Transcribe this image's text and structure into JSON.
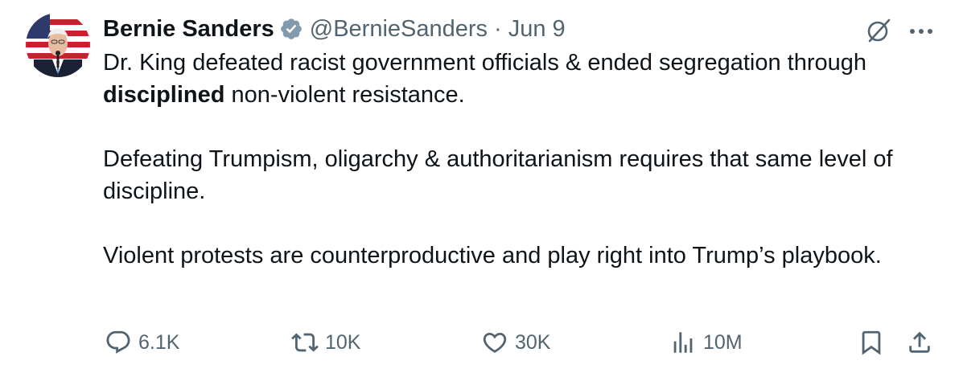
{
  "author": {
    "name": "Bernie Sanders",
    "handle": "@BernieSanders",
    "separator": "·",
    "date": "Jun 9",
    "verified_icon": "verified-badge-icon",
    "badge_color": "#829aab"
  },
  "tweet": {
    "line1_prefix": "Dr. King defeated racist government officials & ended segregation through ",
    "line1_bold": "disciplined",
    "line1_suffix": " non-violent resistance.",
    "paragraph2": "Defeating Trumpism, oligarchy & authoritarianism requires that same level of discipline.",
    "paragraph3": "Violent protests are counterproductive and play right into Trump’s playbook."
  },
  "actions": {
    "replies": "6.1K",
    "reposts": "10K",
    "likes": "30K",
    "views": "10M"
  },
  "colors": {
    "text": "#0f1419",
    "muted": "#536471"
  }
}
